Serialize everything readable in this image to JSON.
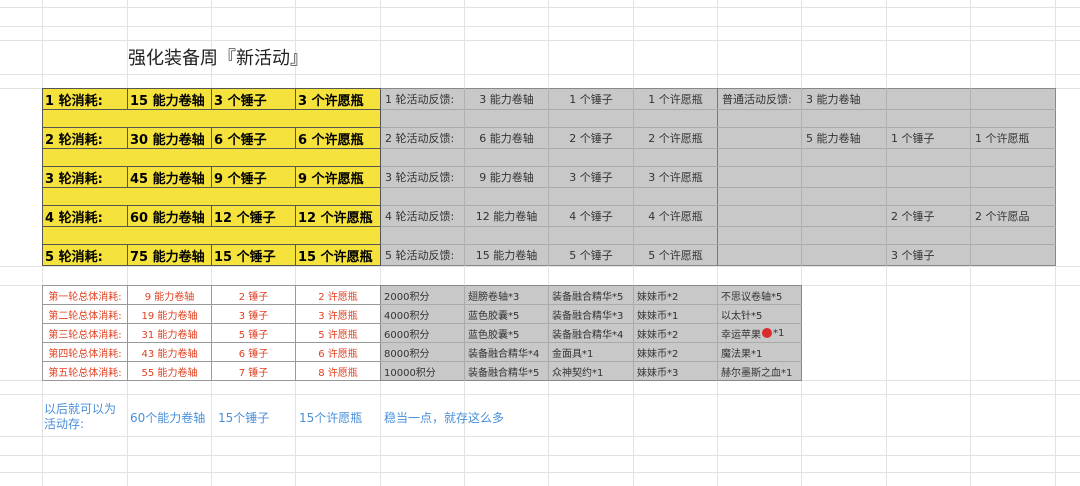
{
  "title": "强化装备周『新活动』",
  "round_costs": [
    {
      "label": "1 轮消耗:",
      "scroll": "15 能力卷轴",
      "hammer": "3 个锤子",
      "bottle": "3 个许愿瓶"
    },
    {
      "label": "2 轮消耗:",
      "scroll": "30 能力卷轴",
      "hammer": "6 个锤子",
      "bottle": "6 个许愿瓶"
    },
    {
      "label": "3 轮消耗:",
      "scroll": "45 能力卷轴",
      "hammer": "9 个锤子",
      "bottle": "9 个许愿瓶"
    },
    {
      "label": "4 轮消耗:",
      "scroll": "60 能力卷轴",
      "hammer": "12 个锤子",
      "bottle": "12 个许愿瓶"
    },
    {
      "label": "5 轮消耗:",
      "scroll": "75 能力卷轴",
      "hammer": "15 个锤子",
      "bottle": "15 个许愿瓶"
    }
  ],
  "round_feedback": [
    {
      "label": "1 轮活动反馈:",
      "scroll": "3 能力卷轴",
      "hammer": "1 个锤子",
      "bottle": "1 个许愿瓶"
    },
    {
      "label": "2 轮活动反馈:",
      "scroll": "6 能力卷轴",
      "hammer": "2 个锤子",
      "bottle": "2 个许愿瓶"
    },
    {
      "label": "3 轮活动反馈:",
      "scroll": "9 能力卷轴",
      "hammer": "3 个锤子",
      "bottle": "3 个许愿瓶"
    },
    {
      "label": "4 轮活动反馈:",
      "scroll": "12 能力卷轴",
      "hammer": "4 个锤子",
      "bottle": "4 个许愿瓶"
    },
    {
      "label": "5 轮活动反馈:",
      "scroll": "15 能力卷轴",
      "hammer": "5 个锤子",
      "bottle": "5 个许愿瓶"
    }
  ],
  "normal_feedback": {
    "label": "普通活动反馈:",
    "r1_scroll": "3 能力卷轴",
    "r2_scroll": "5 能力卷轴",
    "r2_hammer": "1 个锤子",
    "r2_bottle": "1 个许愿瓶",
    "r4_hammer": "2 个锤子",
    "r4_item": "2 个许愿品",
    "r5_hammer": "3 个锤子"
  },
  "totals": [
    {
      "label": "第一轮总体消耗:",
      "scroll": "9 能力卷轴",
      "hammer": "2 锤子",
      "bottle": "2 许愿瓶"
    },
    {
      "label": "第二轮总体消耗:",
      "scroll": "19 能力卷轴",
      "hammer": "3 锤子",
      "bottle": "3 许愿瓶"
    },
    {
      "label": "第三轮总体消耗:",
      "scroll": "31 能力卷轴",
      "hammer": "5 锤子",
      "bottle": "5 许愿瓶"
    },
    {
      "label": "第四轮总体消耗:",
      "scroll": "43 能力卷轴",
      "hammer": "6 锤子",
      "bottle": "6 许愿瓶"
    },
    {
      "label": "第五轮总体消耗:",
      "scroll": "55 能力卷轴",
      "hammer": "7 锤子",
      "bottle": "8 许愿瓶"
    }
  ],
  "rewards": [
    {
      "points": "2000积分",
      "a": "翅膀卷轴*3",
      "b": "装备融合精华*5",
      "c": "妹妹币*2",
      "d": "不思议卷轴*5"
    },
    {
      "points": "4000积分",
      "a": "蓝色胶囊*5",
      "b": "装备融合精华*3",
      "c": "妹妹币*1",
      "d": "以太针*5"
    },
    {
      "points": "6000积分",
      "a": "蓝色胶囊*5",
      "b": "装备融合精华*4",
      "c": "妹妹币*2",
      "d": "幸运苹果",
      "d2": "*1"
    },
    {
      "points": "8000积分",
      "a": "装备融合精华*4",
      "b": "金面具*1",
      "c": "妹妹币*2",
      "d": "魔法果*1"
    },
    {
      "points": "10000积分",
      "a": "装备融合精华*5",
      "b": "众神契约*1",
      "c": "妹妹币*3",
      "d": "赫尔墨斯之血*1"
    }
  ],
  "summary": {
    "label": "以后就可以为活动存:",
    "scroll": "60个能力卷轴",
    "hammer": "15个锤子",
    "bottle": "15个许愿瓶",
    "note": "稳当一点，就存这么多"
  },
  "colors": {
    "yellow": "#f5e23c",
    "gray": "#c8c8c8",
    "red": "#e04020",
    "blue": "#4a90d9"
  }
}
